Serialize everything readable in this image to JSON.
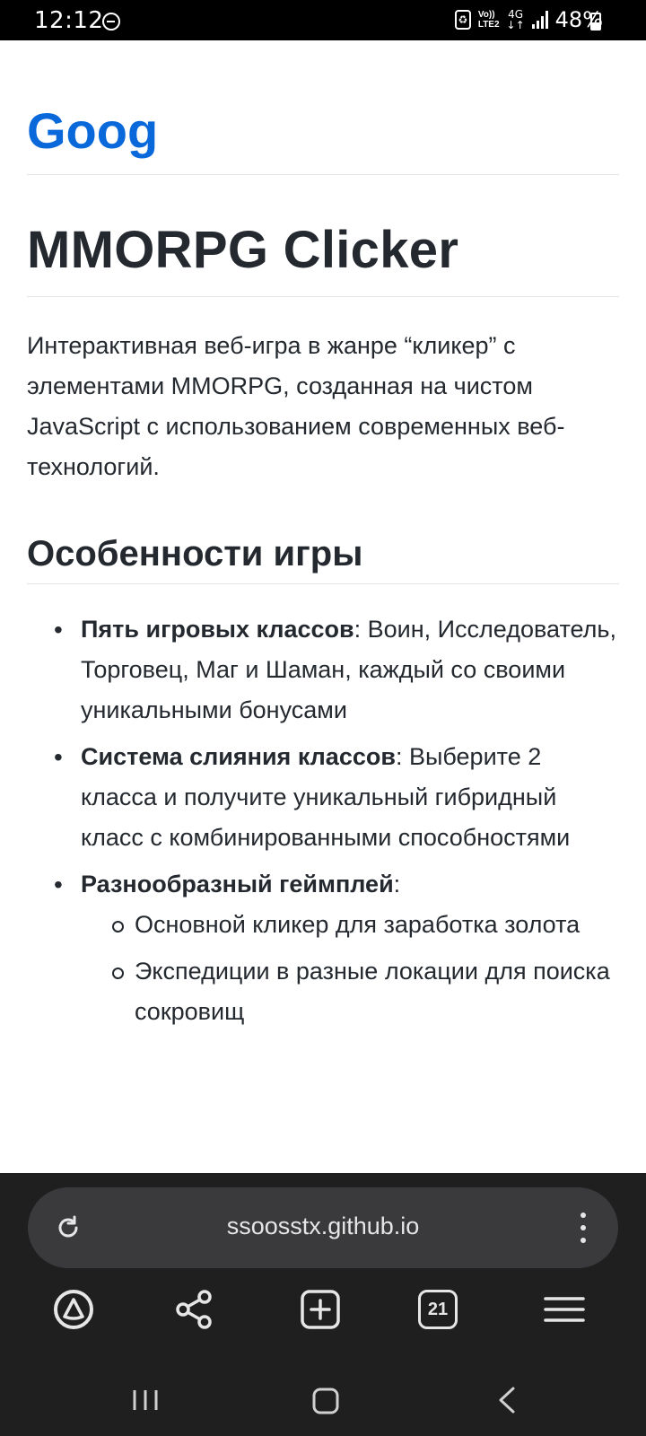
{
  "status_bar": {
    "time": "12:12",
    "network_top": "Vo))",
    "network_bottom": "LTE2",
    "network_type": "4G",
    "battery": "48%"
  },
  "page": {
    "site_logo": "Goog",
    "title": "MMORPG Clicker",
    "intro": "Интерактивная веб-игра в жанре “кликер” с элементами MMORPG, созданная на чистом JavaScript с использованием современных веб-технологий.",
    "section_title": "Особенности игры",
    "features": [
      {
        "bold": "Пять игровых классов",
        "text": ": Воин, Исследователь, Торговец, Маг и Шаман, каждый со своими уникальными бонусами"
      },
      {
        "bold": "Система слияния классов",
        "text": ": Выберите 2 класса и получите уникальный гибридный класс с комбинированными способностями"
      },
      {
        "bold": "Разнообразный геймплей",
        "text": ":"
      }
    ],
    "sub_features": [
      "Основной кликер для заработка золота",
      "Экспедиции в разные локации для поиска сокровищ"
    ]
  },
  "browser": {
    "url": "ssoosstx.github.io",
    "tabs_count": "21"
  },
  "icons": {
    "reload": "reload-icon",
    "menu": "kebab-icon",
    "assistant": "assistant-icon",
    "share": "share-icon",
    "new_tab": "new-tab-icon",
    "tabs": "tabs-icon",
    "hamburger": "hamburger-icon"
  },
  "colors": {
    "link_blue": "#0969da",
    "text": "#24292f",
    "browser_bg": "#1f1f1f",
    "pill_bg": "#3a3a3c"
  }
}
